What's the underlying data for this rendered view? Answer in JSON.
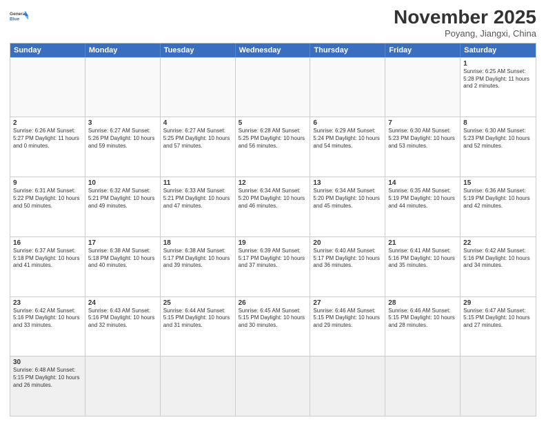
{
  "header": {
    "logo_general": "General",
    "logo_blue": "Blue",
    "title": "November 2025",
    "subtitle": "Poyang, Jiangxi, China"
  },
  "days": [
    "Sunday",
    "Monday",
    "Tuesday",
    "Wednesday",
    "Thursday",
    "Friday",
    "Saturday"
  ],
  "rows": [
    [
      {
        "num": "",
        "text": ""
      },
      {
        "num": "",
        "text": ""
      },
      {
        "num": "",
        "text": ""
      },
      {
        "num": "",
        "text": ""
      },
      {
        "num": "",
        "text": ""
      },
      {
        "num": "",
        "text": ""
      },
      {
        "num": "1",
        "text": "Sunrise: 6:25 AM\nSunset: 5:28 PM\nDaylight: 11 hours and 2 minutes."
      }
    ],
    [
      {
        "num": "2",
        "text": "Sunrise: 6:26 AM\nSunset: 5:27 PM\nDaylight: 11 hours and 0 minutes."
      },
      {
        "num": "3",
        "text": "Sunrise: 6:27 AM\nSunset: 5:26 PM\nDaylight: 10 hours and 59 minutes."
      },
      {
        "num": "4",
        "text": "Sunrise: 6:27 AM\nSunset: 5:25 PM\nDaylight: 10 hours and 57 minutes."
      },
      {
        "num": "5",
        "text": "Sunrise: 6:28 AM\nSunset: 5:25 PM\nDaylight: 10 hours and 56 minutes."
      },
      {
        "num": "6",
        "text": "Sunrise: 6:29 AM\nSunset: 5:24 PM\nDaylight: 10 hours and 54 minutes."
      },
      {
        "num": "7",
        "text": "Sunrise: 6:30 AM\nSunset: 5:23 PM\nDaylight: 10 hours and 53 minutes."
      },
      {
        "num": "8",
        "text": "Sunrise: 6:30 AM\nSunset: 5:23 PM\nDaylight: 10 hours and 52 minutes."
      }
    ],
    [
      {
        "num": "9",
        "text": "Sunrise: 6:31 AM\nSunset: 5:22 PM\nDaylight: 10 hours and 50 minutes."
      },
      {
        "num": "10",
        "text": "Sunrise: 6:32 AM\nSunset: 5:21 PM\nDaylight: 10 hours and 49 minutes."
      },
      {
        "num": "11",
        "text": "Sunrise: 6:33 AM\nSunset: 5:21 PM\nDaylight: 10 hours and 47 minutes."
      },
      {
        "num": "12",
        "text": "Sunrise: 6:34 AM\nSunset: 5:20 PM\nDaylight: 10 hours and 46 minutes."
      },
      {
        "num": "13",
        "text": "Sunrise: 6:34 AM\nSunset: 5:20 PM\nDaylight: 10 hours and 45 minutes."
      },
      {
        "num": "14",
        "text": "Sunrise: 6:35 AM\nSunset: 5:19 PM\nDaylight: 10 hours and 44 minutes."
      },
      {
        "num": "15",
        "text": "Sunrise: 6:36 AM\nSunset: 5:19 PM\nDaylight: 10 hours and 42 minutes."
      }
    ],
    [
      {
        "num": "16",
        "text": "Sunrise: 6:37 AM\nSunset: 5:18 PM\nDaylight: 10 hours and 41 minutes."
      },
      {
        "num": "17",
        "text": "Sunrise: 6:38 AM\nSunset: 5:18 PM\nDaylight: 10 hours and 40 minutes."
      },
      {
        "num": "18",
        "text": "Sunrise: 6:38 AM\nSunset: 5:17 PM\nDaylight: 10 hours and 39 minutes."
      },
      {
        "num": "19",
        "text": "Sunrise: 6:39 AM\nSunset: 5:17 PM\nDaylight: 10 hours and 37 minutes."
      },
      {
        "num": "20",
        "text": "Sunrise: 6:40 AM\nSunset: 5:17 PM\nDaylight: 10 hours and 36 minutes."
      },
      {
        "num": "21",
        "text": "Sunrise: 6:41 AM\nSunset: 5:16 PM\nDaylight: 10 hours and 35 minutes."
      },
      {
        "num": "22",
        "text": "Sunrise: 6:42 AM\nSunset: 5:16 PM\nDaylight: 10 hours and 34 minutes."
      }
    ],
    [
      {
        "num": "23",
        "text": "Sunrise: 6:42 AM\nSunset: 5:16 PM\nDaylight: 10 hours and 33 minutes."
      },
      {
        "num": "24",
        "text": "Sunrise: 6:43 AM\nSunset: 5:16 PM\nDaylight: 10 hours and 32 minutes."
      },
      {
        "num": "25",
        "text": "Sunrise: 6:44 AM\nSunset: 5:15 PM\nDaylight: 10 hours and 31 minutes."
      },
      {
        "num": "26",
        "text": "Sunrise: 6:45 AM\nSunset: 5:15 PM\nDaylight: 10 hours and 30 minutes."
      },
      {
        "num": "27",
        "text": "Sunrise: 6:46 AM\nSunset: 5:15 PM\nDaylight: 10 hours and 29 minutes."
      },
      {
        "num": "28",
        "text": "Sunrise: 6:46 AM\nSunset: 5:15 PM\nDaylight: 10 hours and 28 minutes."
      },
      {
        "num": "29",
        "text": "Sunrise: 6:47 AM\nSunset: 5:15 PM\nDaylight: 10 hours and 27 minutes."
      }
    ],
    [
      {
        "num": "30",
        "text": "Sunrise: 6:48 AM\nSunset: 5:15 PM\nDaylight: 10 hours and 26 minutes."
      },
      {
        "num": "",
        "text": ""
      },
      {
        "num": "",
        "text": ""
      },
      {
        "num": "",
        "text": ""
      },
      {
        "num": "",
        "text": ""
      },
      {
        "num": "",
        "text": ""
      },
      {
        "num": "",
        "text": ""
      }
    ]
  ]
}
